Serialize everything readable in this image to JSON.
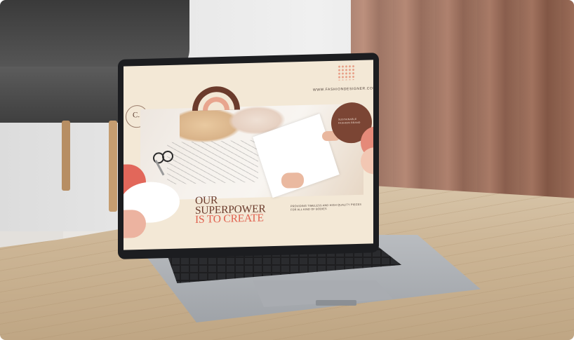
{
  "scene": {
    "description_labels": {
      "url": "WWW.FASHIONDESIGNER.COM",
      "badge": "SUSTAINABLE FASHION BRAND",
      "seal_letter": "C.",
      "headline": [
        "OUR",
        "SUPERPOWER",
        "IS TO CREATE"
      ],
      "tagline": "PROVIDING TIMELESS AND HIGH QUALITY PIECES FOR ALL KIND OF BODIES"
    },
    "colors": {
      "screen_background": "#f3e8d6",
      "brown_accent": "#6b3b2c",
      "coral_accent": "#e0604e",
      "curtain": "#9d6b56",
      "laptop_bezel": "#1c1d20"
    }
  }
}
